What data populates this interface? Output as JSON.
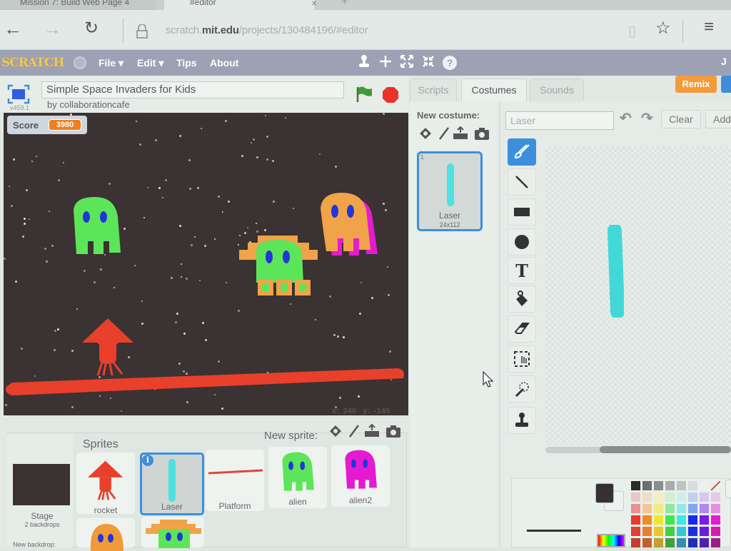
{
  "browser": {
    "tabs": [
      {
        "label": "Mission 7: Build Web Page 4",
        "active": false
      },
      {
        "label": "#editor",
        "active": true
      }
    ],
    "tab_close_icon": "×",
    "new_tab_icon": "+",
    "nav": {
      "back_icon": "←",
      "forward_icon": "→",
      "reload_icon": "↻"
    },
    "url": {
      "domain_prefix": "scratch.",
      "domain": "mit.edu",
      "path": "/projects/130484196/#editor"
    },
    "reading_view_icon": "▯",
    "favorite_icon": "☆",
    "hub_icon": "≡"
  },
  "scratch_menu": {
    "logo": "SCRATCH",
    "items": [
      {
        "label": "File ▾"
      },
      {
        "label": "Edit ▾"
      },
      {
        "label": "Tips"
      },
      {
        "label": "About"
      }
    ],
    "tools": {
      "stamp": "⤓",
      "cut": "✂",
      "grow": "⤢",
      "shrink": "⤡",
      "help": "?"
    },
    "user_initial": "J"
  },
  "project": {
    "title": "Simple Space Invaders for Kids",
    "author": "by collaborationcafe",
    "version": "v459.1"
  },
  "stage": {
    "score_label": "Score",
    "score_value": "3980",
    "mouse_x_label": "x:",
    "mouse_x": "240",
    "mouse_y_label": "y:",
    "mouse_y": "-145",
    "background_color": "#3b3233"
  },
  "sprites_pane": {
    "title": "Sprites",
    "new_sprite_label": "New sprite:",
    "stage_label": "Stage",
    "stage_sub": "2 backdrops",
    "new_backdrop_label": "New backdrop:",
    "sprites": [
      {
        "name": "rocket",
        "color": "#e8402b"
      },
      {
        "name": "Laser",
        "color": "#4fe0e0",
        "selected": true
      },
      {
        "name": "Platform",
        "color": "#e0463a"
      },
      {
        "name": "alien",
        "color": "#5de55a"
      },
      {
        "name": "alien2",
        "color": "#e41bd0"
      },
      {
        "name": "",
        "color": "#f09a3a"
      },
      {
        "name": "",
        "color": "#5de55a"
      }
    ]
  },
  "editor": {
    "tabs": [
      {
        "label": "Scripts",
        "active": false
      },
      {
        "label": "Costumes",
        "active": true
      },
      {
        "label": "Sounds",
        "active": false
      }
    ],
    "remix_label": "Remix",
    "new_costume_label": "New costume:",
    "costumes": [
      {
        "index": "1",
        "name": "Laser",
        "size": "24x112"
      }
    ],
    "costume_name_value": "Laser",
    "clear_label": "Clear",
    "add_label": "Add",
    "tools": [
      "brush",
      "line",
      "rectangle",
      "ellipse",
      "text",
      "fill",
      "eraser",
      "select",
      "reshape",
      "stamp"
    ],
    "active_tool": "brush",
    "primary_color": "#353033",
    "secondary_color": "#eef2ef",
    "palette": [
      [
        "#2b2b2b",
        "#6b6f6e",
        "#8a8e8d",
        "#a8adb0",
        "#bfc4c2",
        "#d8dcda",
        "#eef0ef",
        "transparent"
      ],
      [
        "#e8c8c8",
        "#f0dcc8",
        "#f2f0c0",
        "#d0f0d0",
        "#cceeee",
        "#c0d0f0",
        "#d8c8f0",
        "#e8c8e8"
      ],
      [
        "#e89090",
        "#f0c890",
        "#f0ec80",
        "#90e8a0",
        "#90eaea",
        "#80a8f0",
        "#b088f0",
        "#e890e0"
      ],
      [
        "#e83a2a",
        "#f08a2a",
        "#f0e82a",
        "#3ae84a",
        "#3ae8e8",
        "#1a2ae8",
        "#7a1ae8",
        "#e81ad8"
      ],
      [
        "#e04030",
        "#e88030",
        "#e8c830",
        "#40d040",
        "#30c8e0",
        "#1a30e0",
        "#6a1ae0",
        "#d81ab0"
      ],
      [
        "#c04030",
        "#c06030",
        "#c0a030",
        "#40a040",
        "#3090b0",
        "#2030b0",
        "#5020b0",
        "#a02080"
      ]
    ]
  }
}
